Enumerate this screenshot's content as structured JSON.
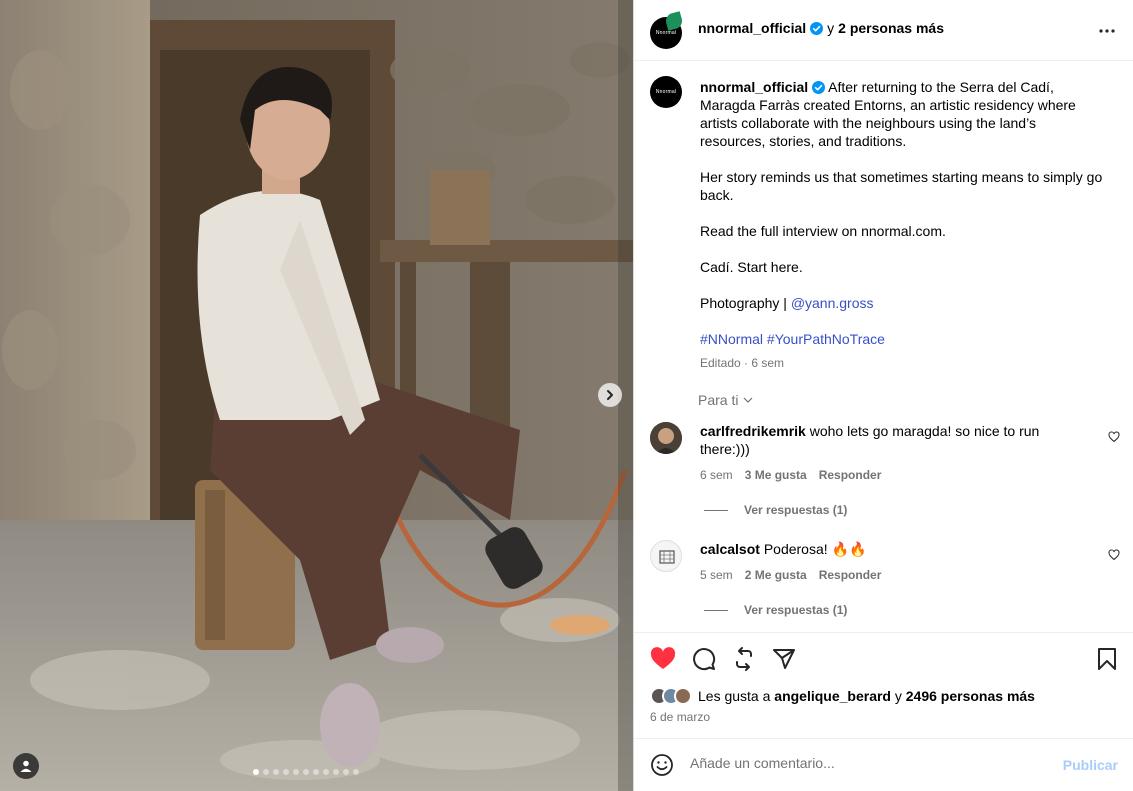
{
  "post": {
    "header": {
      "username": "nnormal_official",
      "collab_connector": "y",
      "collab_others": "2 personas más",
      "brand_mark": "Nnormal"
    },
    "caption": {
      "username": "nnormal_official",
      "first_line": "After returning to the Serra del Cadí, Maragda Farràs created Entorns, an artistic residency where artists collaborate with the neighbours using the land’s resources, stories, and traditions.",
      "p2": "Her story reminds us that sometimes starting means to simply go back.",
      "p3": "Read the full interview on nnormal.com.",
      "p4": "Cadí. Start here.",
      "p5_prefix": "Photography |",
      "p5_mention": "@yann.gross",
      "hashtag1": "#NNormal",
      "hashtag2": "#YourPathNoTrace",
      "edited_meta": "Editado · 6 sem"
    },
    "sort_label": "Para ti",
    "comments": [
      {
        "username": "carlfredrikemrik",
        "text": "woho lets go maragda! so nice to run there:)))",
        "age": "6 sem",
        "likes": "3 Me gusta",
        "reply_label": "Responder",
        "view_replies": "Ver respuestas (1)"
      },
      {
        "username": "calcalsot",
        "text": "Poderosa! 🔥🔥",
        "age": "5 sem",
        "likes": "2 Me gusta",
        "reply_label": "Responder",
        "view_replies": "Ver respuestas (1)"
      }
    ],
    "likes_line": {
      "prefix": "Les gusta a",
      "user": "angelique_berard",
      "connector": "y",
      "others": "2496 personas más"
    },
    "date": "6 de marzo",
    "add_comment": {
      "placeholder": "Añade un comentario...",
      "publish_label": "Publicar"
    },
    "carousel": {
      "total_slides": 11,
      "active_slide": 1
    },
    "colors": {
      "liked_heart": "#ff3040",
      "link_blue": "#3851c7",
      "verified_blue": "#0095f6",
      "publish_disabled": "#a9cdf9",
      "muted_text": "#737373"
    },
    "icons": [
      "verified-badge-icon",
      "more-options-icon",
      "heart-icon",
      "comment-icon",
      "repost-icon",
      "share-icon",
      "bookmark-icon",
      "emoji-icon",
      "chevron-right-icon",
      "user-tag-icon",
      "chevron-down-icon"
    ]
  }
}
